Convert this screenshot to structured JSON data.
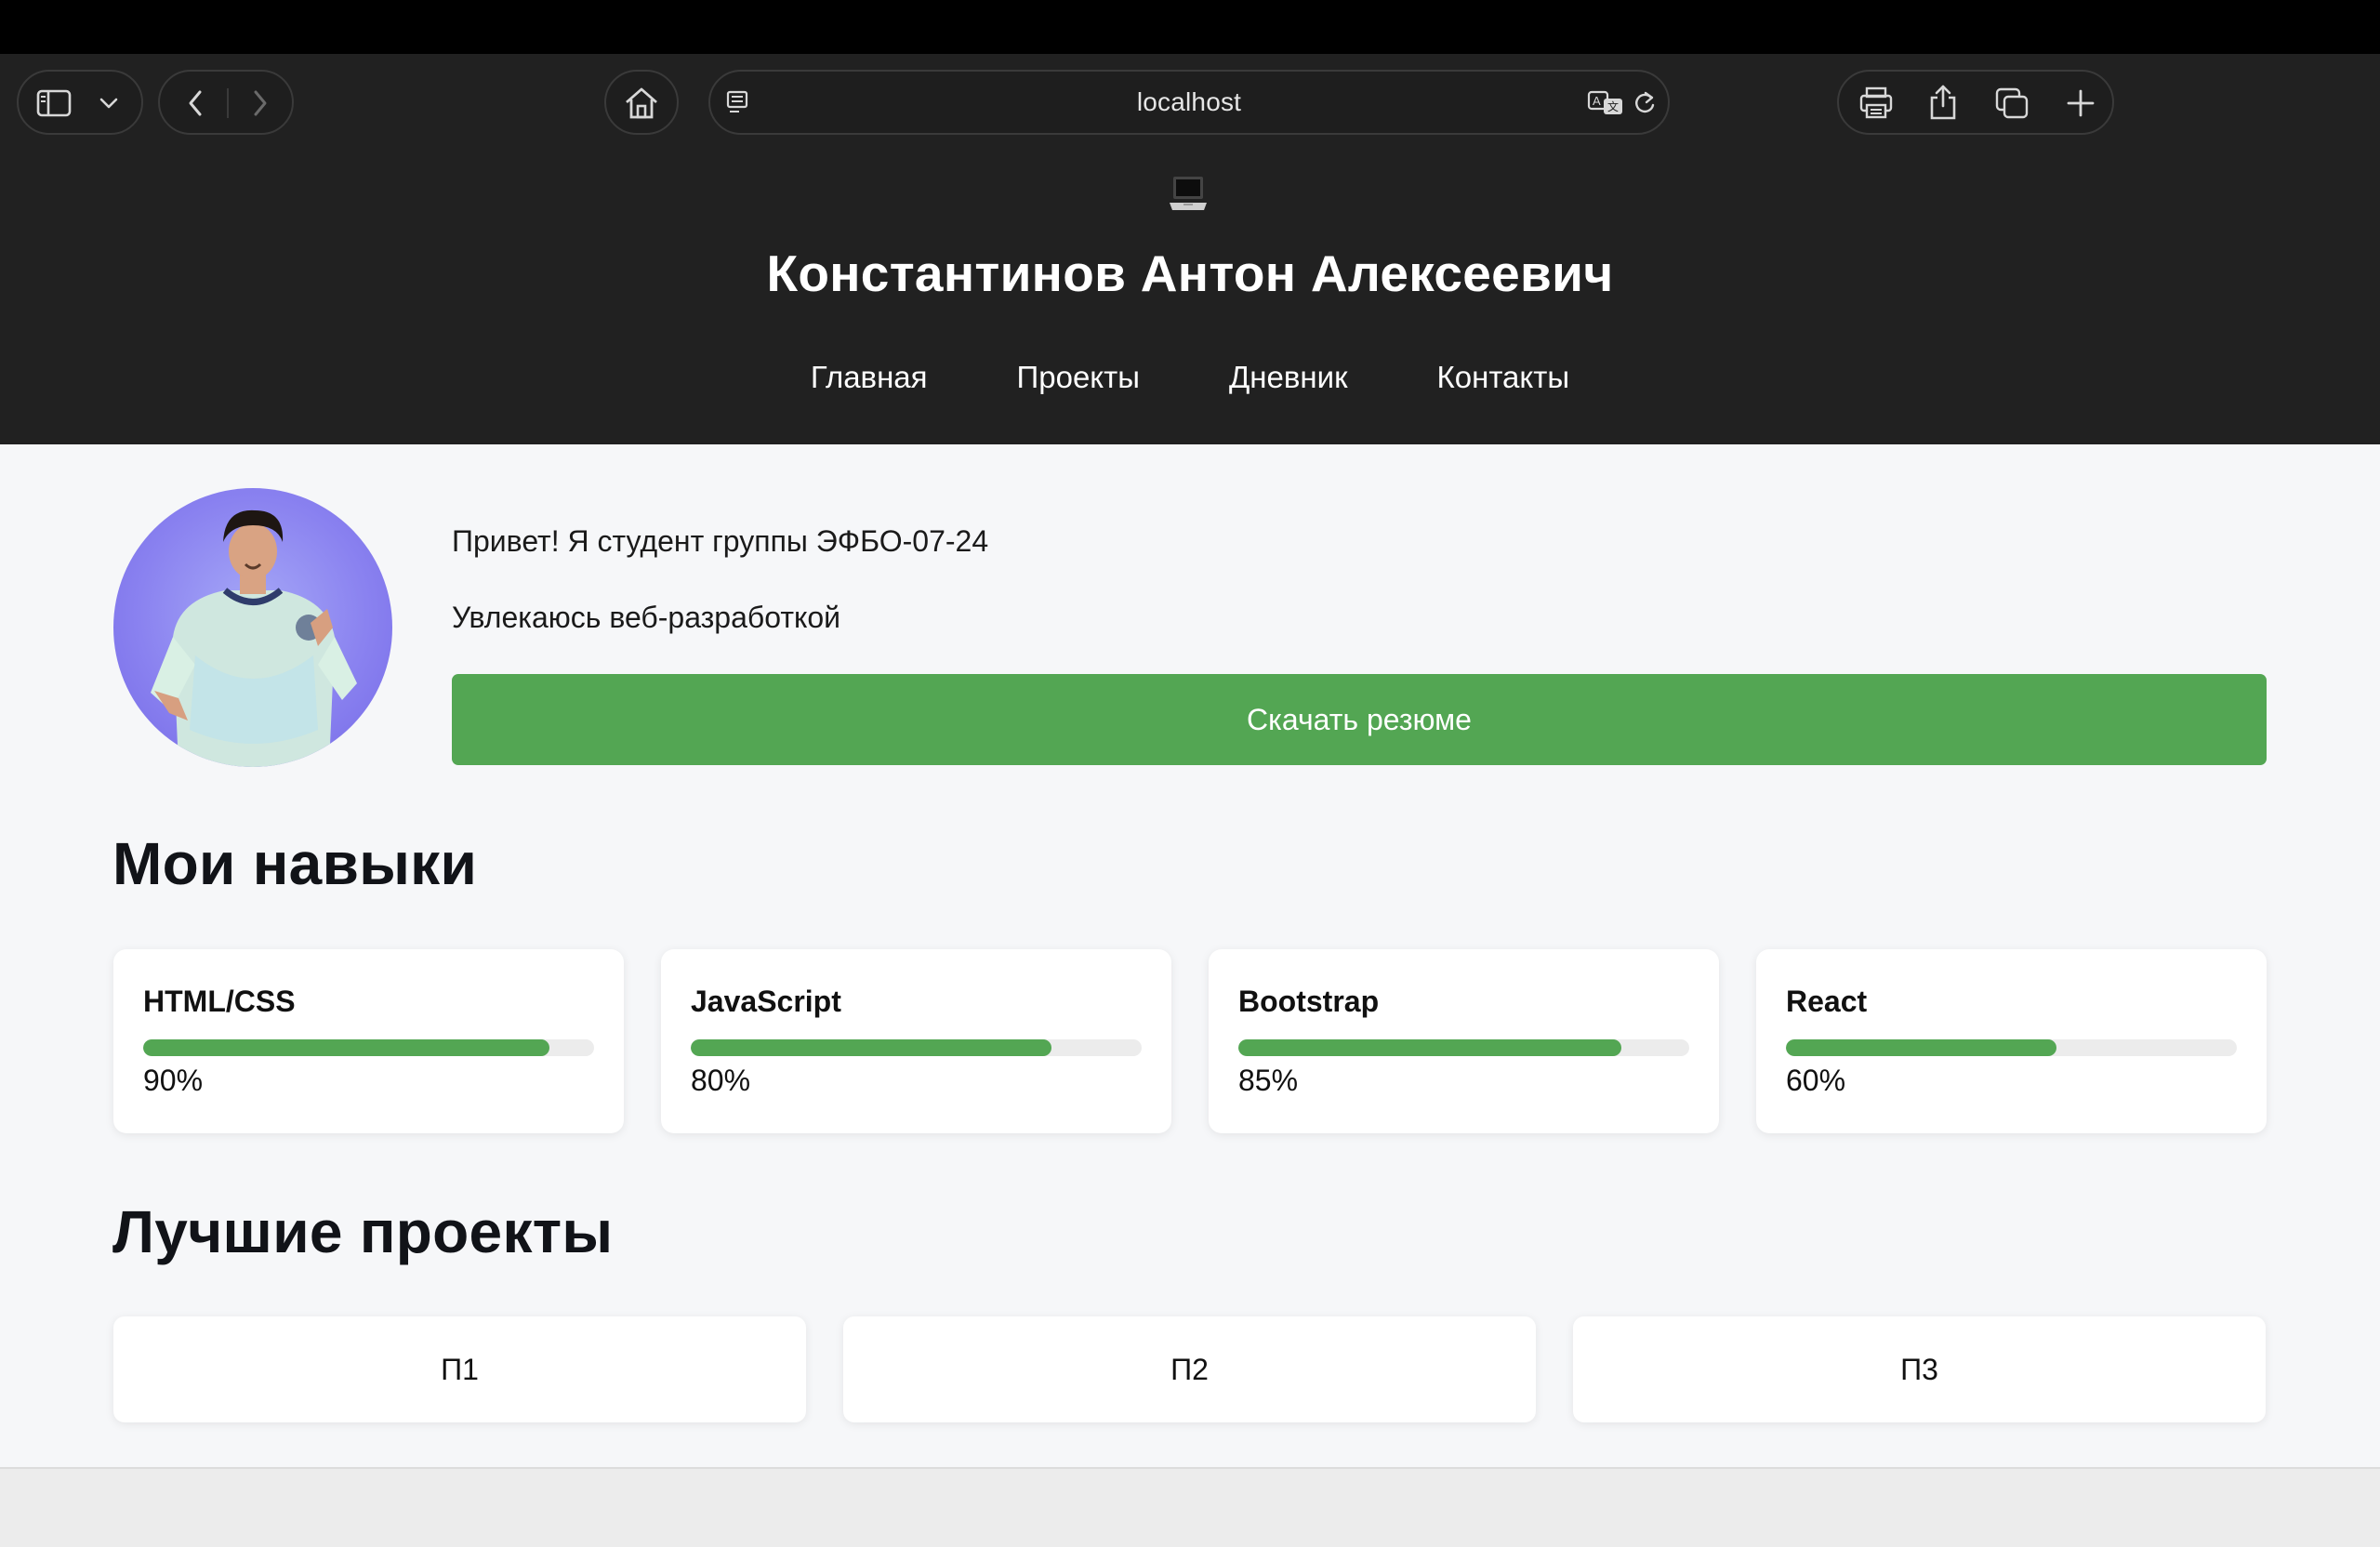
{
  "browser": {
    "address": "localhost",
    "icons": {
      "sidebar": "sidebar-icon",
      "dropdown": "chevron-down-icon",
      "back": "chevron-left-icon",
      "forward": "chevron-right-icon",
      "home": "home-icon",
      "reader": "reader-icon",
      "translate": "translate-icon",
      "reload": "reload-icon",
      "print": "printer-icon",
      "share": "share-icon",
      "tabs": "tabs-icon",
      "new_tab": "plus-icon"
    }
  },
  "header": {
    "emoji": "laptop-icon",
    "title": "Константинов Антон Алексеевич",
    "nav": [
      "Главная",
      "Проекты",
      "Дневник",
      "Контакты"
    ]
  },
  "intro": {
    "line1": "Привет! Я студент группы ЭФБО-07-24",
    "line2": "Увлекаюсь веб-разработкой",
    "resume_button": "Скачать резюме"
  },
  "skills": {
    "title": "Мои навыки",
    "items": [
      {
        "name": "HTML/CSS",
        "label": "90%",
        "level": 0.9
      },
      {
        "name": "JavaScript",
        "label": "80%",
        "level": 0.8
      },
      {
        "name": "Bootstrap",
        "label": "85%",
        "level": 0.85
      },
      {
        "name": "React",
        "label": "60%",
        "level": 0.6
      }
    ]
  },
  "projects": {
    "title": "Лучшие проекты",
    "items": [
      "П1",
      "П2",
      "П3"
    ]
  },
  "colors": {
    "accent": "#53a653",
    "header_bg": "#212121",
    "page_bg": "#f6f7f9"
  }
}
